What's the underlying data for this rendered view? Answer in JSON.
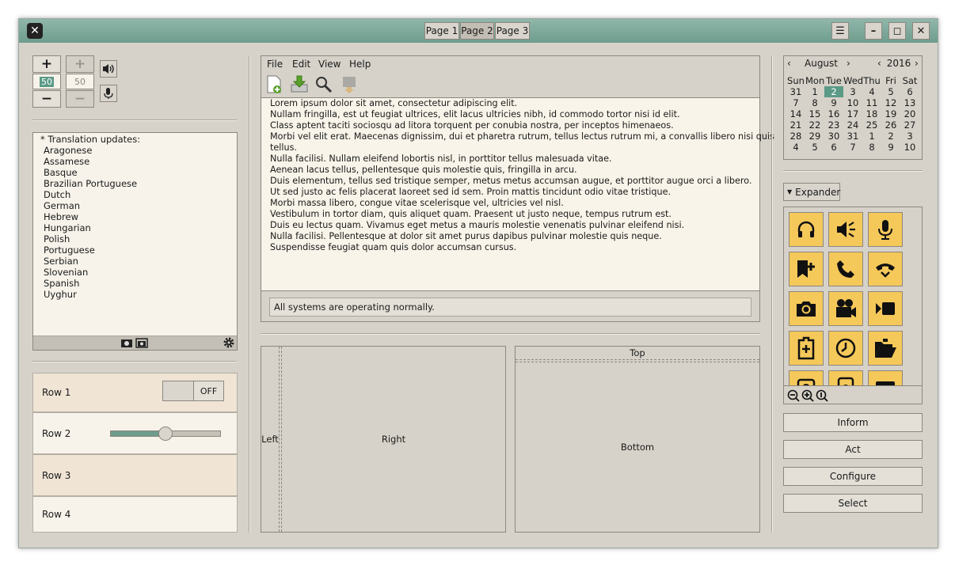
{
  "titlebar": {
    "pages": [
      "Page 1",
      "Page 2",
      "Page 3"
    ],
    "active_page": "Page 2",
    "controls": [
      "menu-icon",
      "minimize-icon",
      "maximize-icon",
      "close-icon"
    ]
  },
  "spinners": {
    "active_value": "50",
    "inactive_value": "50",
    "plus": "+",
    "minus": "−"
  },
  "translation_list": {
    "header": "* Translation updates:",
    "items": [
      "Aragonese",
      "Assamese",
      "Basque",
      "Brazilian Portuguese",
      "Dutch",
      "German",
      "Hebrew",
      "Hungarian",
      "Polish",
      "Portuguese",
      "Serbian",
      "Slovenian",
      "Spanish",
      "Uyghur"
    ]
  },
  "rows": {
    "row1": "Row 1",
    "row1_switch": "OFF",
    "row2": "Row 2",
    "row2_slider_fraction": 0.5,
    "row3": "Row 3",
    "row4": "Row 4"
  },
  "menubar": [
    "File",
    "Edit",
    "View",
    "Help"
  ],
  "text_view": {
    "lines": [
      "Lorem ipsum dolor sit amet, consectetur adipiscing elit.",
      "Nullam fringilla, est ut feugiat ultrices, elit lacus ultricies nibh, id commodo tortor nisi id elit.",
      "Class aptent taciti sociosqu ad litora torquent per conubia nostra, per inceptos himenaeos.",
      "Morbi vel elit erat. Maecenas dignissim, dui et pharetra rutrum, tellus lectus rutrum mi, a convallis libero nisi quis",
      "tellus.",
      "Nulla facilisi. Nullam eleifend lobortis nisl, in porttitor tellus malesuada vitae.",
      "Aenean lacus tellus, pellentesque quis molestie quis, fringilla in arcu.",
      "Duis elementum, tellus sed tristique semper, metus metus accumsan augue, et porttitor augue orci a libero.",
      "Ut sed justo ac felis placerat laoreet sed id sem. Proin mattis tincidunt odio vitae tristique.",
      "Morbi massa libero, congue vitae scelerisque vel, ultricies vel nisl.",
      "Vestibulum in tortor diam, quis aliquet quam. Praesent ut justo neque, tempus rutrum est.",
      "Duis eu lectus quam. Vivamus eget metus a mauris molestie venenatis pulvinar eleifend nisi.",
      "Nulla facilisi. Pellentesque at dolor sit amet purus dapibus pulvinar molestie quis neque.",
      "Suspendisse feugiat quam quis dolor accumsan cursus."
    ]
  },
  "status": "All systems are operating normally.",
  "paned": {
    "left": "Left",
    "right": "Right",
    "top": "Top",
    "bottom": "Bottom"
  },
  "calendar": {
    "month": "August",
    "year": "2016",
    "weekdays": [
      "Sun",
      "Mon",
      "Tue",
      "Wed",
      "Thu",
      "Fri",
      "Sat"
    ],
    "weeks": [
      [
        "31",
        "1",
        "2",
        "3",
        "4",
        "5",
        "6"
      ],
      [
        "7",
        "8",
        "9",
        "10",
        "11",
        "12",
        "13"
      ],
      [
        "14",
        "15",
        "16",
        "17",
        "18",
        "19",
        "20"
      ],
      [
        "21",
        "22",
        "23",
        "24",
        "25",
        "26",
        "27"
      ],
      [
        "28",
        "29",
        "30",
        "31",
        "1",
        "2",
        "3"
      ],
      [
        "4",
        "5",
        "6",
        "7",
        "8",
        "9",
        "10"
      ]
    ],
    "selected_day": "2"
  },
  "expander": {
    "label": "Expander"
  },
  "icon_grid": [
    "headphones-icon",
    "speaker-icon",
    "microphone-icon",
    "bookmark-add-icon",
    "phone-icon",
    "hangup-icon",
    "camera-icon",
    "movie-camera-icon",
    "video-icon",
    "clipboard-add-icon",
    "clock-icon",
    "folder-open-icon",
    "camera-photo-icon",
    "speaker-device-icon",
    "monitor-icon"
  ],
  "colors": {
    "titlebar": "#7fab9c",
    "window_bg": "#d6d2c9",
    "icon_bg": "#f5c85a",
    "highlight": "#5b9a86",
    "text_bg": "#f7f3ea"
  },
  "actions": [
    "Inform",
    "Act",
    "Configure",
    "Select"
  ]
}
